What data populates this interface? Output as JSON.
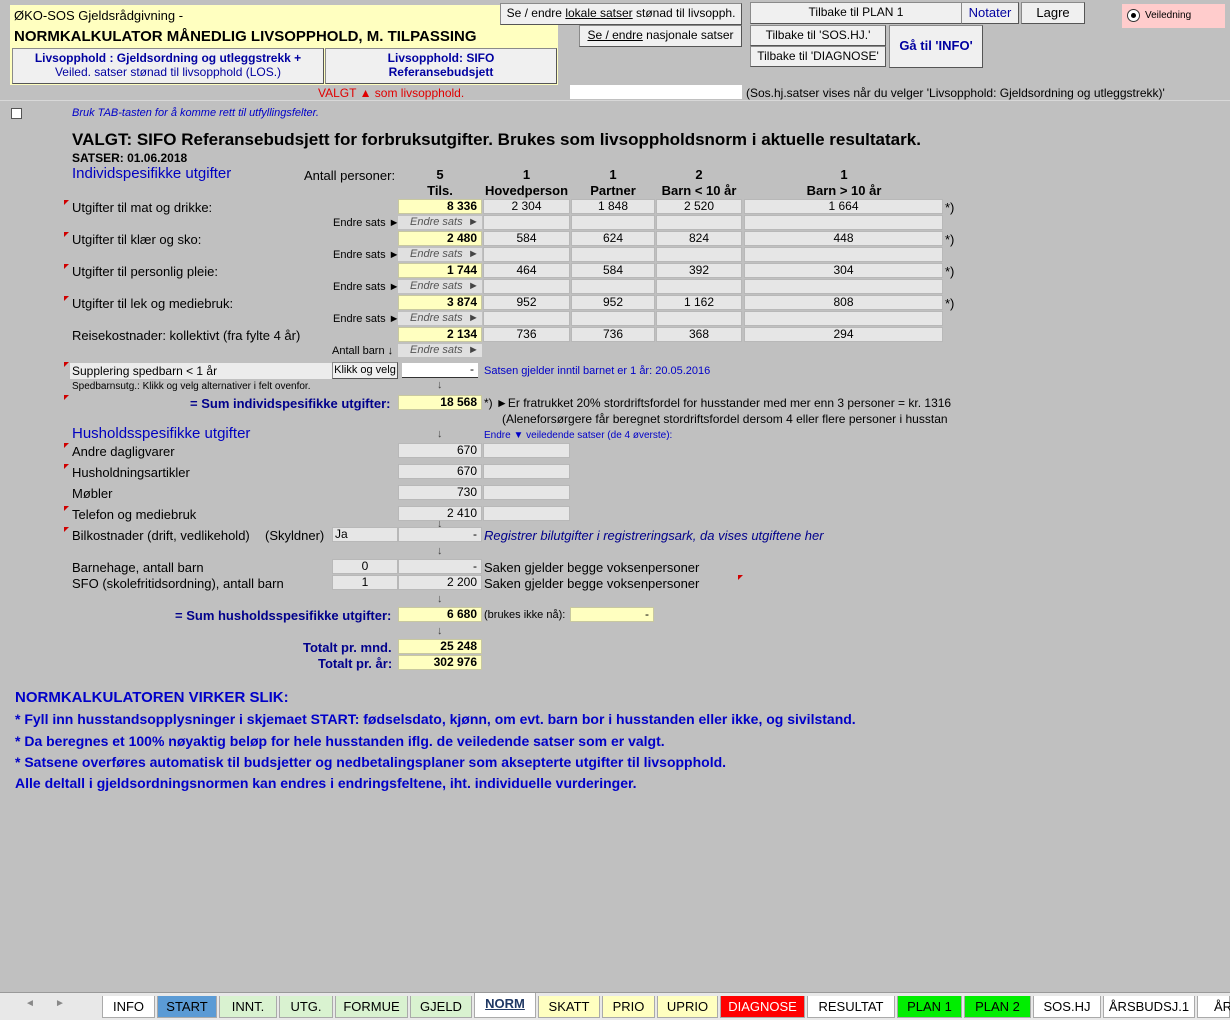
{
  "header": {
    "org": "ØKO-SOS Gjeldsrådgivning -",
    "title": "NORMKALKULATOR MÅNEDLIG LIVSOPPHOLD, M. TILPASSING",
    "btn_gjeld": [
      "Livsopphold : Gjeldsordning og utleggstrekk +",
      "Veiled. satser stønad til livsopphold (LOS.)"
    ],
    "btn_sifo": [
      "Livsopphold: SIFO",
      "Referansebudsjett"
    ],
    "btn_lokale_pre": "Se / endre ",
    "btn_lokale_u": "lokale satser",
    "btn_lokale_post": " stønad til livsopph.",
    "btn_nasjonale_u": "Se / endre",
    "btn_nasjonale_post": " nasjonale satser",
    "btn_plan1": "Tilbake til PLAN 1",
    "btn_notater": "Notater",
    "btn_lagre": "Lagre",
    "btn_soshj": "Tilbake til 'SOS.HJ.'",
    "btn_diagnose": "Tilbake til 'DIAGNOSE'",
    "btn_info": "Gå til 'INFO'",
    "radio_veiledning": "Veiledning",
    "valgt": "VALGT ▲ som livsopphold.",
    "soshj_note": "(Sos.hj.satser vises når du velger 'Livsopphold: Gjeldsordning og utleggstrekk)'"
  },
  "tab_hint": "Bruk TAB-tasten for å komme rett til utfyllingsfelter.",
  "main_title": "VALGT: SIFO Referansebudsjett for forbruksutgifter. Brukes som livsoppholdsnorm i aktuelle resultatark.",
  "satser": "SATSER: 01.06.2018",
  "indiv_heading": "Individspesifikke utgifter",
  "antall_label": "Antall personer:",
  "columns": [
    {
      "count": "5",
      "label": "Tils."
    },
    {
      "count": "1",
      "label": "Hovedperson"
    },
    {
      "count": "1",
      "label": "Partner"
    },
    {
      "count": "2",
      "label": "Barn < 10 år"
    },
    {
      "count": "1",
      "label": "Barn > 10 år"
    }
  ],
  "rows": [
    {
      "label": "Utgifter til mat og drikke:",
      "values": [
        "8 336",
        "2 304",
        "1 848",
        "2 520",
        "1 664"
      ],
      "star": "*)"
    },
    {
      "label": "Utgifter til klær og sko:",
      "values": [
        "2 480",
        "584",
        "624",
        "824",
        "448"
      ],
      "star": "*)"
    },
    {
      "label": "Utgifter til personlig pleie:",
      "values": [
        "1 744",
        "464",
        "584",
        "392",
        "304"
      ],
      "star": "*)"
    },
    {
      "label": "Utgifter til lek og mediebruk:",
      "values": [
        "3 874",
        "952",
        "952",
        "1 162",
        "808"
      ],
      "star": "*)"
    },
    {
      "label": "Reisekostnader: kollektivt (fra fylte 4 år)",
      "values": [
        "2 134",
        "736",
        "736",
        "368",
        "294"
      ],
      "star": ""
    }
  ],
  "endre_sats_lbl": "Endre sats ►",
  "endre_sats_cell": "Endre sats",
  "antall_barn": "Antall barn ↓",
  "spedbarn_label": "Supplering spedbarn < 1 år",
  "klikk_velg": "Klikk og velg",
  "spedbarn_value": "-",
  "spedbarn_note": "Satsen gjelder inntil barnet er 1 år:  20.05.2016",
  "spedbarn_help": "Spedbarnsutg.: Klikk og velg alternativer i felt ovenfor.",
  "sum_indiv_label": "= Sum individspesifikke utgifter:",
  "sum_indiv_value": "18 568",
  "stordrift1": "*) ►Er fratrukket 20% stordriftsfordel for husstander med mer enn 3 personer = kr. 1316",
  "stordrift2": "(Aleneforsørgere får beregnet stordriftsfordel dersom 4 eller flere personer i husstan",
  "hush_heading": "Husholdsspesifikke utgifter",
  "endre_veil": "Endre ▼ veiledende satser (de 4 øverste):",
  "hush_rows": [
    {
      "label": "Andre dagligvarer",
      "value": "670"
    },
    {
      "label": "Husholdningsartikler",
      "value": "670"
    },
    {
      "label": "Møbler",
      "value": "730"
    },
    {
      "label": "Telefon og mediebruk",
      "value": "2 410"
    }
  ],
  "bil_label": "Bilkostnader (drift, vedlikehold)",
  "skyldner": "(Skyldner)",
  "bil_ja": "Ja",
  "bil_value": "-",
  "bil_note": "Registrer bilutgifter i registreringsark, da vises utgiftene her",
  "barnehage_label": "Barnehage, antall barn",
  "barnehage_count": "0",
  "barnehage_value": "-",
  "barnehage_note": "Saken gjelder begge voksenpersoner",
  "sfo_label": "SFO (skolefritidsordning), antall barn",
  "sfo_count": "1",
  "sfo_value": "2 200",
  "sfo_note": "Saken gjelder begge voksenpersoner",
  "sum_hush_label": "= Sum husholdsspesifikke utgifter:",
  "sum_hush_value": "6 680",
  "brukes_ikke": "(brukes ikke nå):",
  "brukes_value": "-",
  "totalt_mnd_label": "Totalt pr. mnd.",
  "totalt_mnd": "25 248",
  "totalt_aar_label": "Totalt pr. år:",
  "totalt_aar": "302 976",
  "info_lines": [
    "NORMKALKULATOREN VIRKER SLIK:",
    "* Fyll inn husstandsopplysninger i skjemaet START: fødselsdato, kjønn, om evt. barn bor i husstanden eller ikke, og sivilstand.",
    "* Da beregnes et 100% nøyaktig beløp for hele husstanden iflg. de veiledende satser som er valgt.",
    "*  Satsene overføres automatisk til budsjetter og nedbetalingsplaner som aksepterte utgifter til livsopphold.",
    "Alle deltall i gjeldsordningsnormen kan endres i endringsfeltene, iht. individuelle vurderinger."
  ],
  "sheet_tabs": [
    {
      "label": "INFO",
      "color": "#ffffff"
    },
    {
      "label": "START",
      "color": "#5b9bd5"
    },
    {
      "label": "INNT.",
      "color": "#d9f2d0"
    },
    {
      "label": "UTG.",
      "color": "#d9f2d0"
    },
    {
      "label": "FORMUE",
      "color": "#d9f2d0"
    },
    {
      "label": "GJELD",
      "color": "#d9f2d0"
    },
    {
      "label": "NORM",
      "color": "#ffffff"
    },
    {
      "label": "SKATT",
      "color": "#ffffc0"
    },
    {
      "label": "PRIO",
      "color": "#ffffc0"
    },
    {
      "label": "UPRIO",
      "color": "#ffffc0"
    },
    {
      "label": "DIAGNOSE",
      "color": "#ff0000"
    },
    {
      "label": "RESULTAT",
      "color": "#ffffff"
    },
    {
      "label": "PLAN 1",
      "color": "#00ee00"
    },
    {
      "label": "PLAN 2",
      "color": "#00ee00"
    },
    {
      "label": "SOS.HJ",
      "color": "#ffffff"
    },
    {
      "label": "ÅRSBUDSJ.1",
      "color": "#ffffff"
    },
    {
      "label": "ÅR",
      "color": "#ffffff"
    }
  ],
  "nav_prev": "◄",
  "nav_next": "►"
}
